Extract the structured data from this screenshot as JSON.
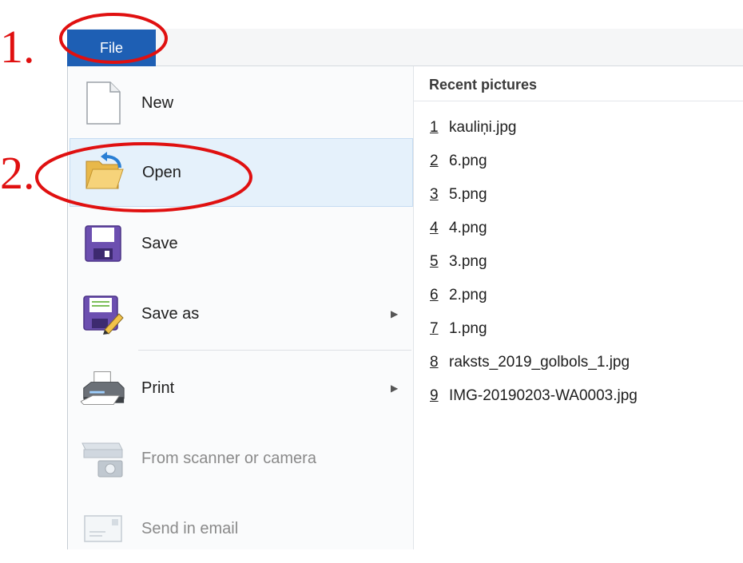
{
  "file_tab": {
    "label": "File"
  },
  "menu_items": [
    {
      "label": "New"
    },
    {
      "label": "Open"
    },
    {
      "label": "Save"
    },
    {
      "label": "Save as"
    },
    {
      "label": "Print"
    },
    {
      "label": "From scanner or camera"
    },
    {
      "label": "Send in email"
    }
  ],
  "recent": {
    "title": "Recent pictures",
    "items": [
      {
        "num": "1",
        "name": "kauliņi.jpg"
      },
      {
        "num": "2",
        "name": "6.png"
      },
      {
        "num": "3",
        "name": "5.png"
      },
      {
        "num": "4",
        "name": "4.png"
      },
      {
        "num": "5",
        "name": "3.png"
      },
      {
        "num": "6",
        "name": "2.png"
      },
      {
        "num": "7",
        "name": "1.png"
      },
      {
        "num": "8",
        "name": "raksts_2019_golbols_1.jpg"
      },
      {
        "num": "9",
        "name": "IMG-20190203-WA0003.jpg"
      }
    ]
  },
  "annotations": {
    "step1": "1.",
    "step2": "2."
  },
  "colors": {
    "file_tab": "#1e5fb4",
    "hover": "#e5f1fb",
    "annotation": "#e01010"
  }
}
